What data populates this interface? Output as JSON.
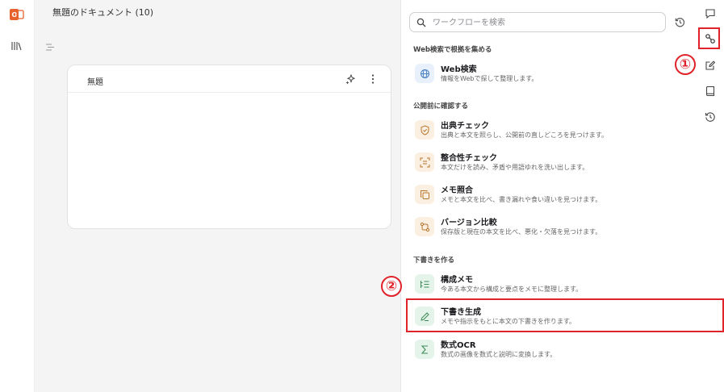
{
  "document": {
    "title": "無題のドキュメント (10)",
    "card_title": "無題"
  },
  "search": {
    "placeholder": "ワークフローを検索"
  },
  "sections": [
    {
      "heading": "Web検索で根拠を集める",
      "items": [
        {
          "title": "Web検索",
          "desc": "情報をWebで探して整理します。",
          "icon": "globe-icon"
        }
      ]
    },
    {
      "heading": "公開前に確認する",
      "items": [
        {
          "title": "出典チェック",
          "desc": "出典と本文を照らし、公開前の直しどころを見つけます。",
          "icon": "shield-check-icon"
        },
        {
          "title": "整合性チェック",
          "desc": "本文だけを読み、矛盾や用語ゆれを洗い出します。",
          "icon": "scan-icon"
        },
        {
          "title": "メモ照合",
          "desc": "メモと本文を比べ、書き漏れや食い違いを見つけます。",
          "icon": "copy-icon"
        },
        {
          "title": "バージョン比較",
          "desc": "保存版と現在の本文を比べ、悪化・欠落を見つけます。",
          "icon": "compare-icon"
        }
      ]
    },
    {
      "heading": "下書きを作る",
      "items": [
        {
          "title": "構成メモ",
          "desc": "今ある本文から構成と要点をメモに整理します。",
          "icon": "list-icon"
        },
        {
          "title": "下書き生成",
          "desc": "メモや指示をもとに本文の下書きを作ります。",
          "icon": "pencil-icon"
        },
        {
          "title": "数式OCR",
          "desc": "数式の画像を数式と説明に変換します。",
          "icon": "sigma-icon"
        }
      ]
    }
  ],
  "annotations": {
    "badge_1": "①",
    "badge_2": "②"
  },
  "colors": {
    "highlight": "#e0232b",
    "doc_background": "#f4f4f5"
  }
}
